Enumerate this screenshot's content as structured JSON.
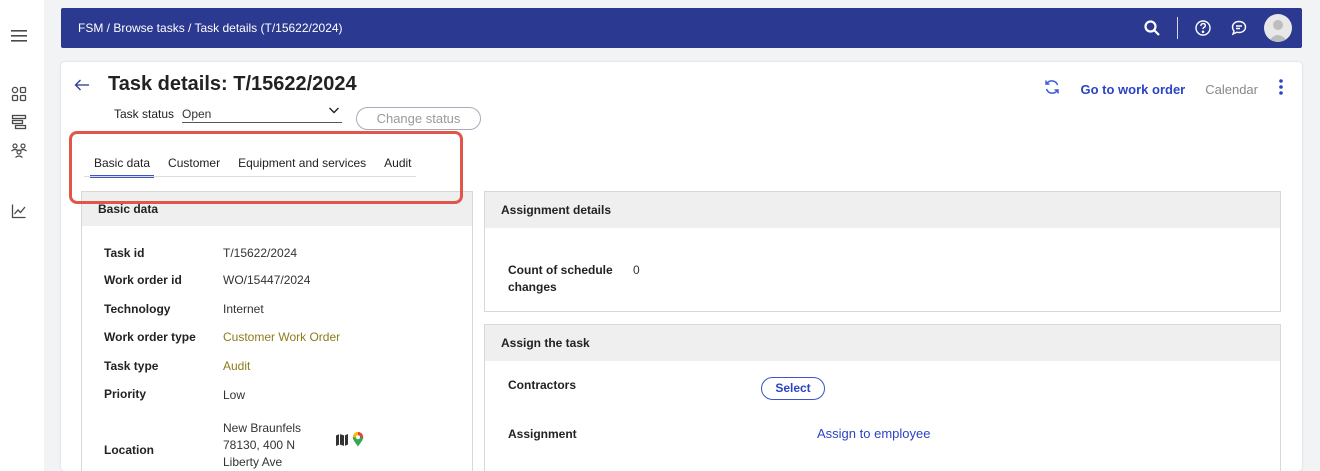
{
  "rail": {
    "icons": [
      "hamburger-menu-icon",
      "dashboard-icon",
      "tasks-icon",
      "team-icon",
      "analytics-icon"
    ]
  },
  "topbar": {
    "breadcrumb": "FSM / Browse tasks / Task details (T/15622/2024)",
    "icons": [
      "search-icon",
      "help-icon",
      "chat-icon",
      "user-avatar"
    ]
  },
  "header": {
    "title": "Task details: T/15622/2024",
    "status_label": "Task status",
    "status_value": "Open",
    "change_status": "Change status",
    "actions": {
      "go_to_work_order": "Go to work order",
      "calendar": "Calendar"
    }
  },
  "tabs": [
    {
      "label": "Basic data",
      "active": true
    },
    {
      "label": "Customer",
      "active": false
    },
    {
      "label": "Equipment and services",
      "active": false
    },
    {
      "label": "Audit",
      "active": false
    }
  ],
  "basic_data": {
    "title": "Basic data",
    "fields": [
      {
        "label": "Task id",
        "value": "T/15622/2024"
      },
      {
        "label": "Work order id",
        "value": "WO/15447/2024"
      },
      {
        "label": "Technology",
        "value": "Internet"
      },
      {
        "label": "Work order type",
        "value": "Customer Work Order"
      },
      {
        "label": "Task type",
        "value": "Audit"
      },
      {
        "label": "Priority",
        "value": "Low"
      }
    ],
    "location_label": "Location",
    "location_lines": [
      "New Braunfels",
      "78130, 400 N",
      "Liberty Ave"
    ]
  },
  "assignment_details": {
    "title": "Assignment details",
    "count_label_1": "Count of schedule",
    "count_label_2": "changes",
    "count_value": "0"
  },
  "assign_task": {
    "title": "Assign the task",
    "contractors_label": "Contractors",
    "select_button": "Select",
    "assignment_label": "Assignment",
    "assign_link": "Assign to employee"
  },
  "colors": {
    "topbar": "#2b3990",
    "accent": "#2b44c6",
    "olive_link": "#8b7d1a",
    "highlight": "#e0574a"
  }
}
